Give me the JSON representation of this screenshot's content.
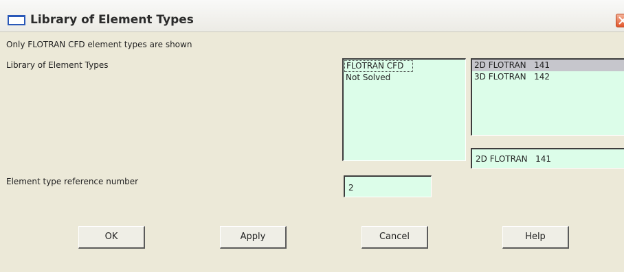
{
  "window": {
    "title": "Library of Element Types"
  },
  "info_text": "Only FLOTRAN CFD element types are shown",
  "library_label": "Library of Element Types",
  "category_list": {
    "items": [
      "FLOTRAN CFD",
      "Not Solved"
    ]
  },
  "type_list": {
    "items": [
      "2D FLOTRAN   141",
      "3D FLOTRAN   142"
    ]
  },
  "selected_type": "2D FLOTRAN   141",
  "ref_number": {
    "label": "Element type reference number",
    "value": "2"
  },
  "buttons": {
    "ok": "OK",
    "apply": "Apply",
    "cancel": "Cancel",
    "help": "Help"
  },
  "colors": {
    "list_bg": "#dcfde9",
    "dialog_bg": "#ece9d8",
    "close_button": "#e1562b"
  },
  "icons": {
    "window": "window-icon",
    "close": "close-icon"
  }
}
